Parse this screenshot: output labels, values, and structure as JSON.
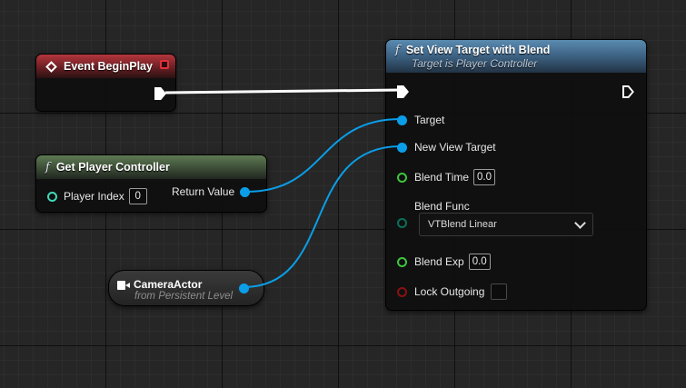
{
  "nodes": {
    "event_begin_play": {
      "title": "Event BeginPlay"
    },
    "get_player_controller": {
      "title": "Get Player Controller",
      "player_index_label": "Player Index",
      "player_index_value": "0",
      "return_value_label": "Return Value"
    },
    "camera_actor": {
      "title": "CameraActor",
      "subtitle": "from Persistent Level"
    },
    "set_view_target": {
      "title": "Set View Target with Blend",
      "subtitle": "Target is Player Controller",
      "target_label": "Target",
      "new_view_target_label": "New View Target",
      "blend_time_label": "Blend Time",
      "blend_time_value": "0.0",
      "blend_func_label": "Blend Func",
      "blend_func_value": "VTBlend Linear",
      "blend_exp_label": "Blend Exp",
      "blend_exp_value": "0.0",
      "lock_outgoing_label": "Lock Outgoing",
      "lock_outgoing_checked": false
    }
  },
  "colors": {
    "exec_wire": "#ffffff",
    "object_wire": "#0a9ee8",
    "event_header": "#b5363c",
    "pure_header": "#5e7a53",
    "function_header": "#5a8bb0",
    "float_pin": "#3dc53d",
    "bool_pin": "#8c1010"
  },
  "icons": {
    "function": "f",
    "event": "diamond-icon",
    "camera": "camera-icon",
    "stop": "stop-icon"
  }
}
